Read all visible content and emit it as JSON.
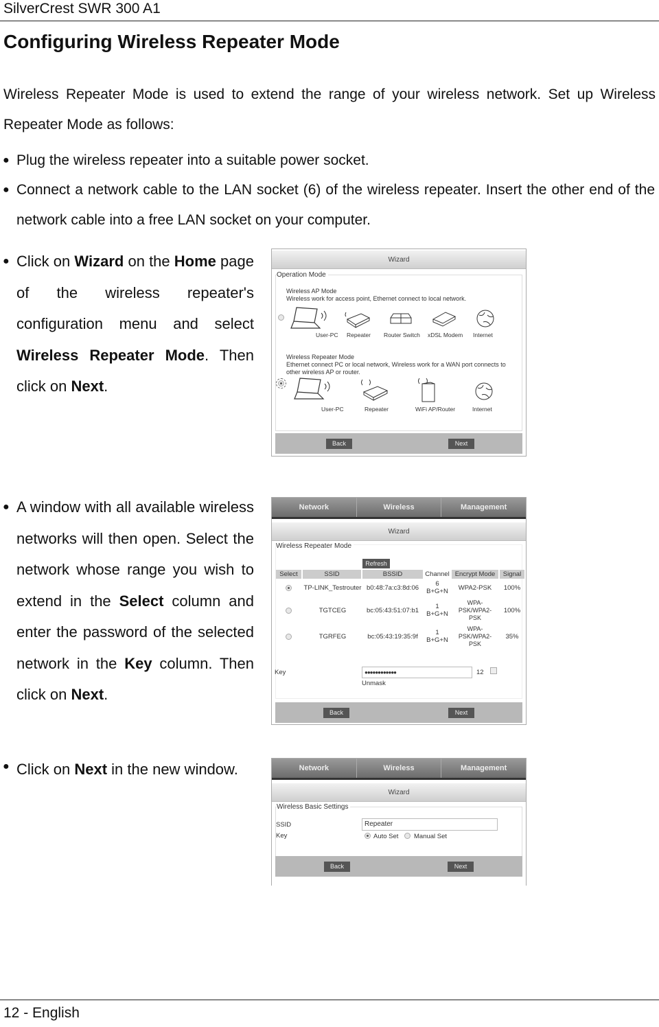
{
  "header": {
    "product": "SilverCrest SWR 300 A1"
  },
  "title": "Configuring Wireless Repeater Mode",
  "intro": "Wireless Repeater Mode is used to extend the range of your wireless network. Set up Wireless Repeater Mode as follows:",
  "bullets": {
    "b1": "Plug the wireless repeater into a suitable power socket.",
    "b2": "Connect a network cable to the LAN socket (6) of the wireless repeater. Insert the other end of the network cable into a free LAN socket on your computer.",
    "b3": {
      "t1": "Click on ",
      "w": "Wizard",
      "t2": " on the ",
      "h": "Home",
      "t3": " page of the wireless repeater's configuration menu and select ",
      "m": "Wireless Repeater Mode",
      "t4": ". Then click on ",
      "n": "Next",
      "t5": "."
    },
    "b4": {
      "t1": "A window with all available wireless networks will then open. Select the network whose range you wish to extend in the ",
      "s": "Select",
      "t2": " column and enter the password of the selected network in the ",
      "k": "Key",
      "t3": " column. Then click on ",
      "n": "Next",
      "t4": "."
    },
    "b5": {
      "t1": "Click on ",
      "n": "Next",
      "t2": " in the new window."
    }
  },
  "shot1": {
    "title": "Wizard",
    "legend": "Operation Mode",
    "ap_title": "Wireless AP Mode",
    "ap_desc": "Wireless work for access point, Ethernet connect to local network.",
    "ap_devices": [
      "User-PC",
      "Repeater",
      "Router Switch",
      "xDSL Modem",
      "Internet"
    ],
    "rep_title": "Wireless Repeater Mode",
    "rep_desc": "Ethernet connect PC or local network, Wireless work for a WAN port connects to other wireless AP or router.",
    "rep_devices": [
      "User-PC",
      "Repeater",
      "WiFi AP/Router",
      "Internet"
    ],
    "selected": "Wireless Repeater Mode",
    "back": "Back",
    "next": "Next"
  },
  "shot2": {
    "tabs": [
      "Network",
      "Wireless",
      "Management"
    ],
    "title": "Wizard",
    "legend": "Wireless Repeater Mode",
    "refresh": "Refresh",
    "columns": [
      "Select",
      "SSID",
      "BSSID",
      "Channel",
      "Encrypt Mode",
      "Signal"
    ],
    "rows": [
      {
        "selected": true,
        "ssid": "TP-LINK_Testrouter",
        "bssid": "b0:48:7a:c3:8d:06",
        "channel": "6",
        "band": "B+G+N",
        "encrypt": "WPA2-PSK",
        "signal": "100%"
      },
      {
        "selected": false,
        "ssid": "TGTCEG",
        "bssid": "bc:05:43:51:07:b1",
        "channel": "1",
        "band": "B+G+N",
        "encrypt": "WPA-PSK/WPA2-PSK",
        "signal": "100%"
      },
      {
        "selected": false,
        "ssid": "TGRFEG",
        "bssid": "bc:05:43:19:35:9f",
        "channel": "1",
        "band": "B+G+N",
        "encrypt": "WPA-PSK/WPA2-PSK",
        "signal": "35%"
      }
    ],
    "key_label": "Key",
    "key_value": "●●●●●●●●●●●●",
    "key_length": "12",
    "unmask": "Unmask",
    "back": "Back",
    "next": "Next"
  },
  "shot3": {
    "tabs": [
      "Network",
      "Wireless",
      "Management"
    ],
    "title": "Wizard",
    "legend": "Wireless Basic Settings",
    "ssid_label": "SSID",
    "ssid_value": "Repeater",
    "key_label": "Key",
    "auto": "Auto Set",
    "manual": "Manual Set",
    "back": "Back",
    "next": "Next"
  },
  "footer": {
    "page": "12 - English"
  }
}
